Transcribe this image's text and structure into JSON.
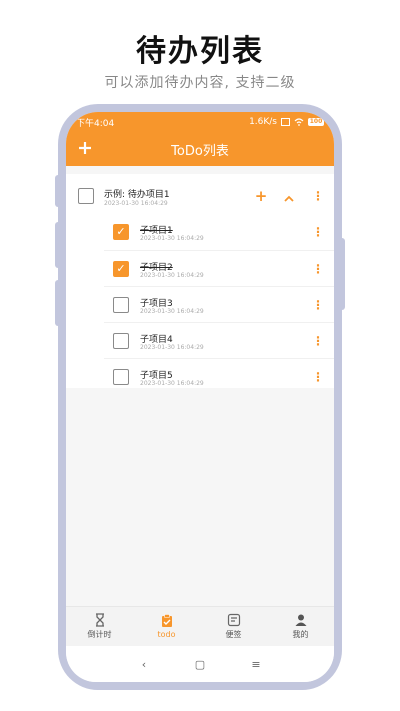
{
  "promo": {
    "title": "待办列表",
    "subtitle": "可以添加待办内容, 支持二级"
  },
  "status_bar": {
    "time": "下午4:04",
    "speed": "1.6K/s",
    "battery": "100"
  },
  "app_bar": {
    "title": "ToDo列表",
    "add_icon": "plus-icon"
  },
  "parent_item": {
    "title": "示例: 待办项目1",
    "time": "2023-01-30 16:04:29",
    "checked": false,
    "add_label": "+",
    "collapse_label": "^"
  },
  "sub_items": [
    {
      "title": "子项目1",
      "time": "2023-01-30 16:04:29",
      "checked": true
    },
    {
      "title": "子项目2",
      "time": "2023-01-30 16:04:29",
      "checked": true
    },
    {
      "title": "子项目3",
      "time": "2023-01-30 16:04:29",
      "checked": false
    },
    {
      "title": "子项目4",
      "time": "2023-01-30 16:04:29",
      "checked": false
    },
    {
      "title": "子项目5",
      "time": "2023-01-30 16:04:29",
      "checked": false
    }
  ],
  "more_label": "⋮",
  "check_mark": "✓",
  "bottom_nav": [
    {
      "label": "倒计时",
      "icon": "hourglass-icon",
      "active": false
    },
    {
      "label": "todo",
      "icon": "clipboard-check-icon",
      "active": true
    },
    {
      "label": "便签",
      "icon": "note-icon",
      "active": false
    },
    {
      "label": "我的",
      "icon": "person-icon",
      "active": false
    }
  ],
  "system_nav": {
    "back": "‹",
    "home": "▢",
    "menu": "≡"
  },
  "colors": {
    "accent": "#f7962c",
    "frame": "#c2c6dd",
    "background": "#f6f6f6"
  }
}
